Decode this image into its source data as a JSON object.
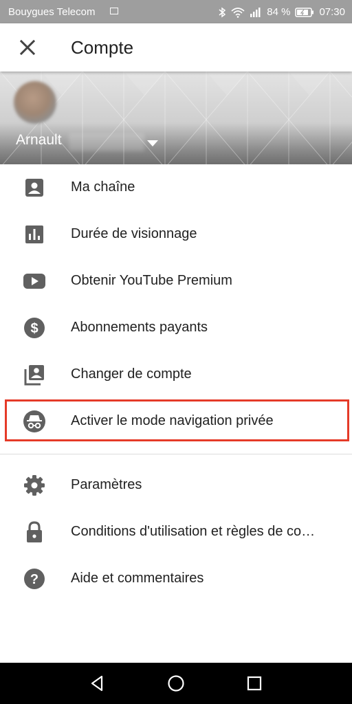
{
  "status_bar": {
    "carrier": "Bouygues Telecom",
    "battery": "84 %",
    "time": "07:30"
  },
  "app_bar": {
    "title": "Compte",
    "close_icon": "close-icon"
  },
  "account": {
    "name": "Arnault"
  },
  "menu": {
    "items": [
      {
        "label": "Ma chaîne",
        "icon": "account-box-icon"
      },
      {
        "label": "Durée de visionnage",
        "icon": "bar-chart-icon"
      },
      {
        "label": "Obtenir YouTube Premium",
        "icon": "youtube-icon"
      },
      {
        "label": "Abonnements payants",
        "icon": "dollar-icon"
      },
      {
        "label": "Changer de compte",
        "icon": "switch-account-icon"
      },
      {
        "label": "Activer le mode navigation privée",
        "icon": "incognito-icon"
      }
    ],
    "items2": [
      {
        "label": "Paramètres",
        "icon": "gear-icon"
      },
      {
        "label": "Conditions d'utilisation et règles de confidentialité",
        "icon": "lock-icon"
      },
      {
        "label": "Aide et commentaires",
        "icon": "help-icon"
      }
    ]
  },
  "colors": {
    "highlight": "#e53a28",
    "icon": "#606060",
    "text": "#212121"
  }
}
